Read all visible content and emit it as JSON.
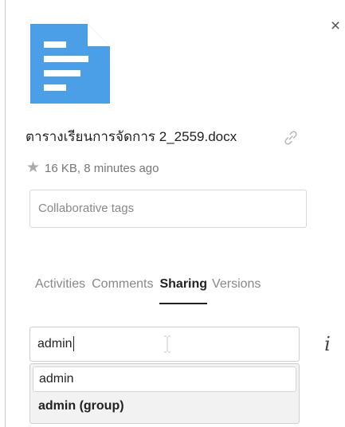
{
  "panel": {
    "close_label": "×",
    "file": {
      "name": "ตารางเรียนการจัดการ 2_2559.docx",
      "meta": "16 KB, 8 minutes ago",
      "icon": "document-icon",
      "icon_color": "#4a9fe6"
    },
    "tags_placeholder": "Collaborative tags",
    "tabs": [
      {
        "label": "Activities",
        "active": false
      },
      {
        "label": "Comments",
        "active": false
      },
      {
        "label": "Sharing",
        "active": true
      },
      {
        "label": "Versions",
        "active": false
      }
    ],
    "share": {
      "input_value": "admin",
      "info_label": "i",
      "suggestions": [
        {
          "label": "admin"
        },
        {
          "label": "admin (group)"
        }
      ]
    }
  }
}
